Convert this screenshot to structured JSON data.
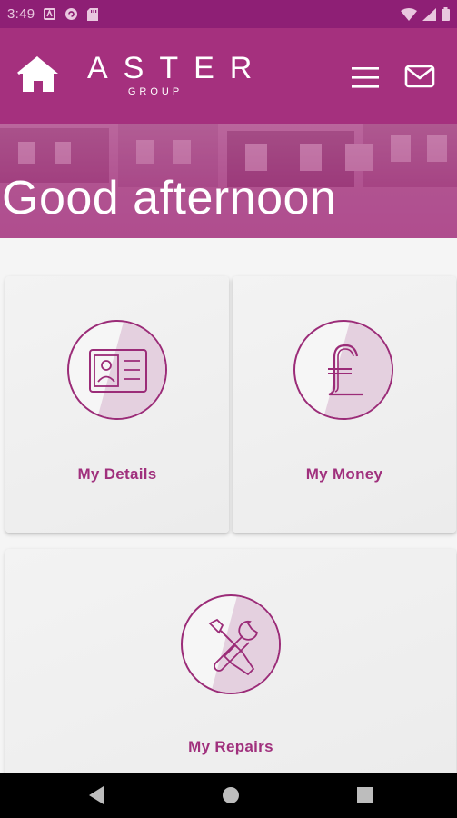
{
  "status_bar": {
    "time": "3:49",
    "icons_left": [
      "notification-icon",
      "sync-icon",
      "sd-card-icon"
    ],
    "icons_right": [
      "wifi-icon",
      "signal-icon",
      "battery-icon"
    ]
  },
  "header": {
    "logo_main": "ASTER",
    "logo_sub": "GROUP",
    "icons": [
      "home-icon",
      "menu-icon",
      "mail-icon"
    ]
  },
  "banner": {
    "greeting": "Good afternoon"
  },
  "tiles": [
    {
      "label": "My Details",
      "icon": "id-card-icon"
    },
    {
      "label": "My Money",
      "icon": "pound-icon"
    },
    {
      "label": "My Repairs",
      "icon": "tools-icon"
    }
  ],
  "colors": {
    "brand": "#a5307e",
    "status_bar": "#8e1f75",
    "tile_text": "#a0307d",
    "background": "#f5f5f5"
  },
  "nav_bar": {
    "buttons": [
      "back-icon",
      "home-circle-icon",
      "recents-icon"
    ]
  }
}
